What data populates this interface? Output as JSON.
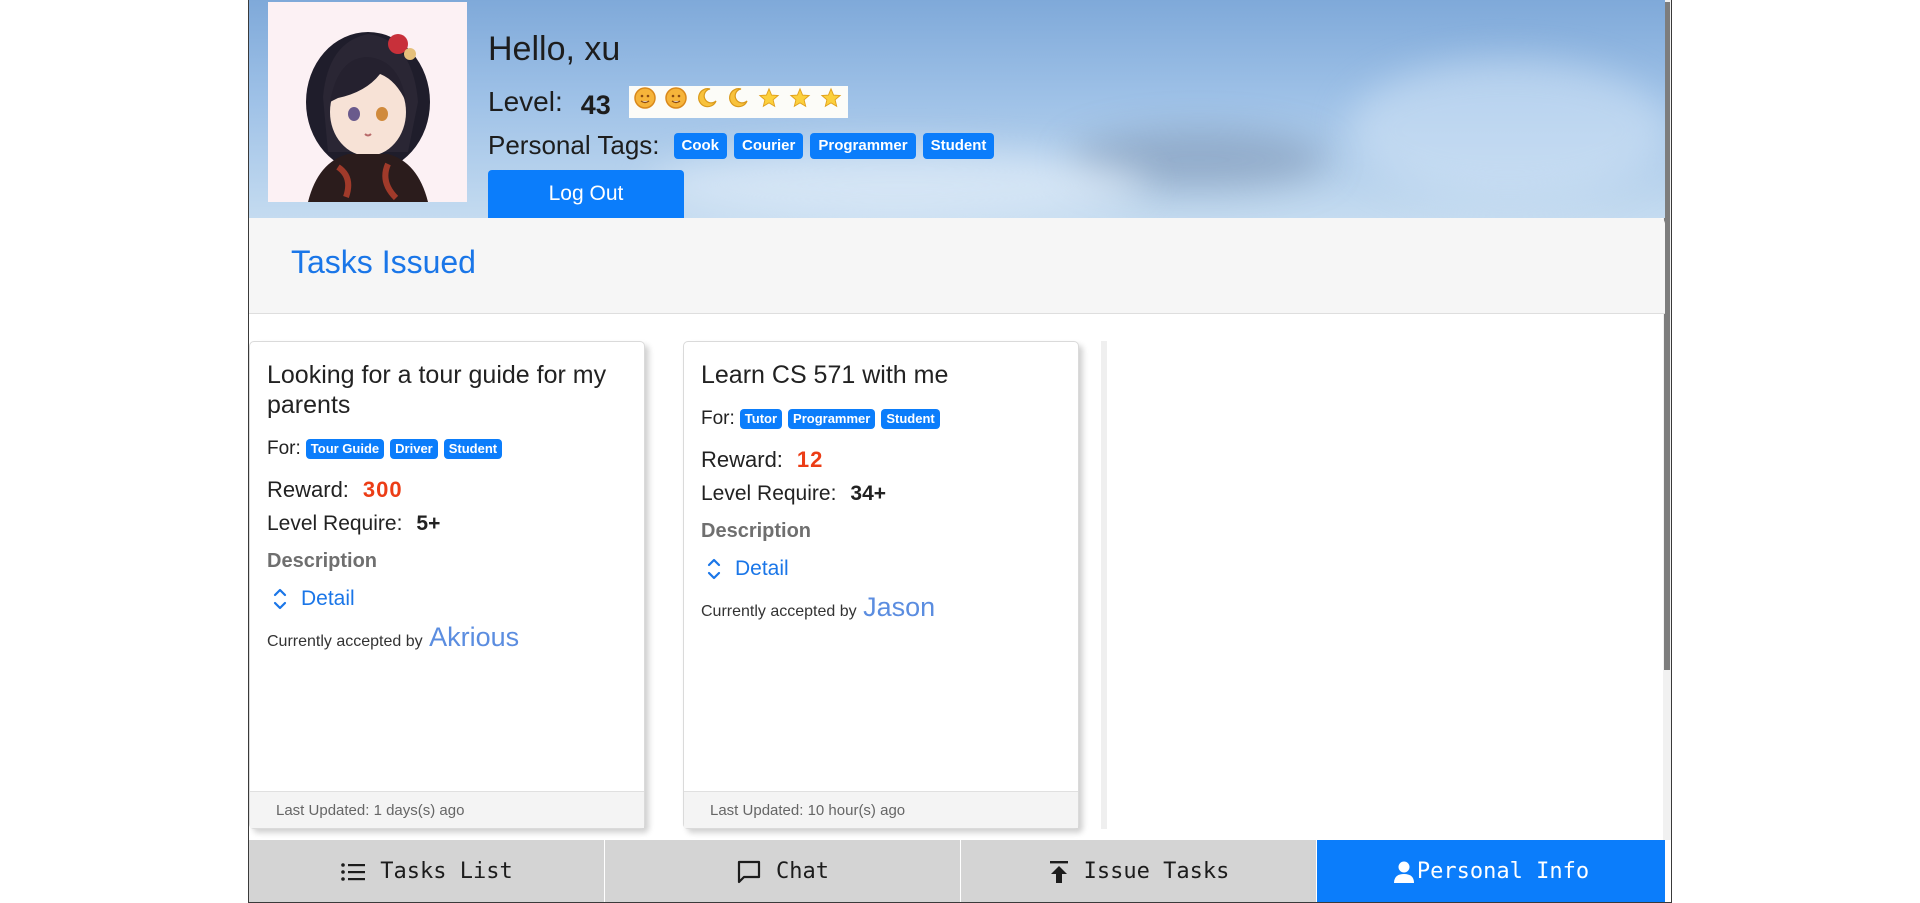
{
  "header": {
    "greeting": "Hello, xu",
    "level_label": "Level:",
    "level_value": "43",
    "level_icons": [
      "sun-face-icon",
      "sun-face-icon",
      "moon-icon",
      "moon-icon",
      "star-icon",
      "star-icon",
      "star-icon"
    ],
    "tags_label": "Personal Tags:",
    "tags": [
      "Cook",
      "Courier",
      "Programmer",
      "Student"
    ],
    "logout_label": "Log Out"
  },
  "section": {
    "title": "Tasks Issued"
  },
  "cards": [
    {
      "title": "Looking for a tour guide for my parents",
      "for_label": "For:",
      "tags": [
        "Tour Guide",
        "Driver",
        "Student"
      ],
      "reward_label": "Reward:",
      "reward_value": "300",
      "level_label": "Level Require:",
      "level_value": "5+",
      "description_label": "Description",
      "detail_label": "Detail",
      "accepted_label": "Currently accepted by",
      "accepted_by": "Akrious",
      "footer": "Last Updated: 1 days(s) ago"
    },
    {
      "title": "Learn CS 571 with me",
      "for_label": "For:",
      "tags": [
        "Tutor",
        "Programmer",
        "Student"
      ],
      "reward_label": "Reward:",
      "reward_value": "12",
      "level_label": "Level Require:",
      "level_value": "34+",
      "description_label": "Description",
      "detail_label": "Detail",
      "accepted_label": "Currently accepted by",
      "accepted_by": "Jason",
      "footer": "Last Updated: 10 hour(s) ago"
    }
  ],
  "nav": [
    {
      "label": "Tasks List",
      "icon": "list-icon",
      "active": false
    },
    {
      "label": "Chat",
      "icon": "chat-icon",
      "active": false
    },
    {
      "label": "Issue Tasks",
      "icon": "upload-icon",
      "active": false
    },
    {
      "label": "Personal Info",
      "icon": "person-icon",
      "active": true
    }
  ],
  "colors": {
    "primary": "#0b7dfb",
    "reward": "#ec3d16",
    "title_blue": "#1a76e8",
    "nav_bg": "#d4d4d4"
  }
}
